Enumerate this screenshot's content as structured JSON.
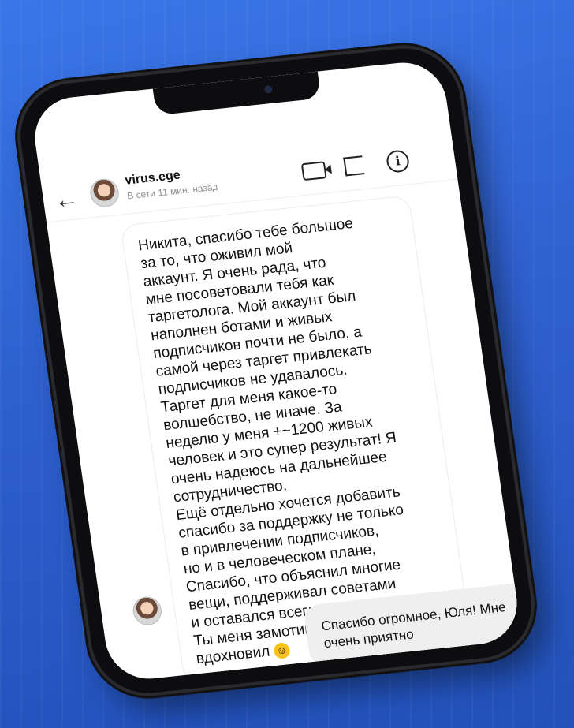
{
  "header": {
    "back_icon": "arrow-left-icon",
    "username": "virus.ege",
    "status": "В сети 11 мин. назад",
    "icons": [
      "video-icon",
      "flag-icon",
      "info-icon"
    ]
  },
  "messages": {
    "incoming_text": "Никита, спасибо тебе большое\nза то, что оживил мой\nаккаунт. Я очень рада, что\nмне посоветовали тебя как\nтаргетолога. Мой аккаунт был\nнаполнен ботами и живых\nподписчиков почти не было, а\nсамой через таргет привлекать\nподписчиков не удавалось.\nТаргет для меня какое-то\nволшебство, не иначе. За\nнеделю у меня +~1200 живых\nчеловек и это супер результат! Я\nочень надеюсь на дальнейшее\nсотрудничество.\nЕщё отдельно хочется добавить\nспасибо за поддержку не только\nв привлечении подписчиков,\nно и в человеческом плане,\nСпасибо, что объяснил многие\nвещи, поддерживал советами\nи оставался всегда на связи.\nТы меня замотивировал и\nвдохновил",
    "incoming_emoji": "smiling-face-emoji",
    "outgoing_text": "Спасибо огромное, Юля! Мне очень приятно"
  }
}
